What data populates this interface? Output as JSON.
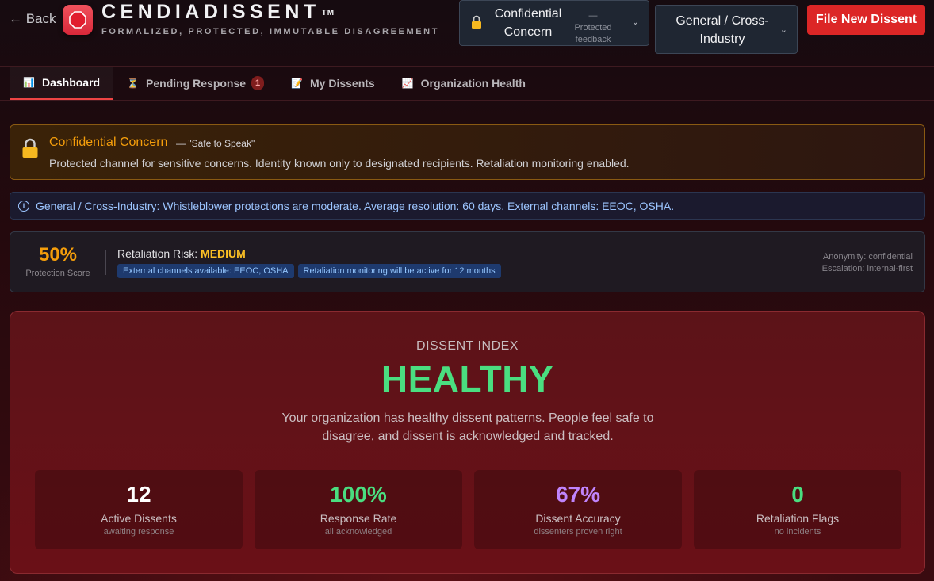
{
  "header": {
    "back_label": "← Back",
    "brand": "CENDIADISSENT",
    "trademark": "TM",
    "tagline": "FORMALIZED, PROTECTED, IMMUTABLE DISAGREEMENT",
    "mode_select": {
      "value": "Confidential Concern",
      "hint": "— Protected feedback"
    },
    "industry_select": {
      "value": "General / Cross-Industry"
    },
    "file_button": "File New Dissent"
  },
  "tabs": [
    {
      "icon": "📊",
      "icon_name": "bar-chart-icon",
      "label": "Dashboard",
      "active": true
    },
    {
      "icon": "⏳",
      "icon_name": "hourglass-icon",
      "label": "Pending Response",
      "badge": "1"
    },
    {
      "icon": "📝",
      "icon_name": "memo-icon",
      "label": "My Dissents"
    },
    {
      "icon": "📈",
      "icon_name": "trend-chart-icon",
      "label": "Organization Health"
    }
  ],
  "confidential_banner": {
    "title": "Confidential Concern",
    "tagline": "— \"Safe to Speak\"",
    "description": "Protected channel for sensitive concerns. Identity known only to designated recipients. Retaliation monitoring enabled."
  },
  "industry_info": "General / Cross-Industry: Whistleblower protections are moderate. Average resolution: 60 days. External channels: EEOC, OSHA.",
  "protection": {
    "score": "50%",
    "score_label": "Protection Score",
    "risk_label": "Retaliation Risk:",
    "risk_value": "MEDIUM",
    "chips": [
      "External channels available: EEOC, OSHA",
      "Retaliation monitoring will be active for 12 months"
    ],
    "anonymity": "Anonymity: confidential",
    "escalation": "Escalation: internal-first"
  },
  "dissent_index": {
    "label": "DISSENT INDEX",
    "status": "HEALTHY",
    "description": "Your organization has healthy dissent patterns. People feel safe to disagree, and dissent is acknowledged and tracked.",
    "stats": [
      {
        "value": "12",
        "label": "Active Dissents",
        "sub": "awaiting response",
        "color": "#ffffff"
      },
      {
        "value": "100%",
        "label": "Response Rate",
        "sub": "all acknowledged",
        "color": "#4ade80"
      },
      {
        "value": "67%",
        "label": "Dissent Accuracy",
        "sub": "dissenters proven right",
        "color": "#c084fc"
      },
      {
        "value": "0",
        "label": "Retaliation Flags",
        "sub": "no incidents",
        "color": "#4ade80"
      }
    ]
  },
  "colors": {
    "accent_red": "#dc2626",
    "warning_amber": "#f59e0b",
    "healthy_green": "#4ade80",
    "info_blue": "#9cc5ff"
  }
}
